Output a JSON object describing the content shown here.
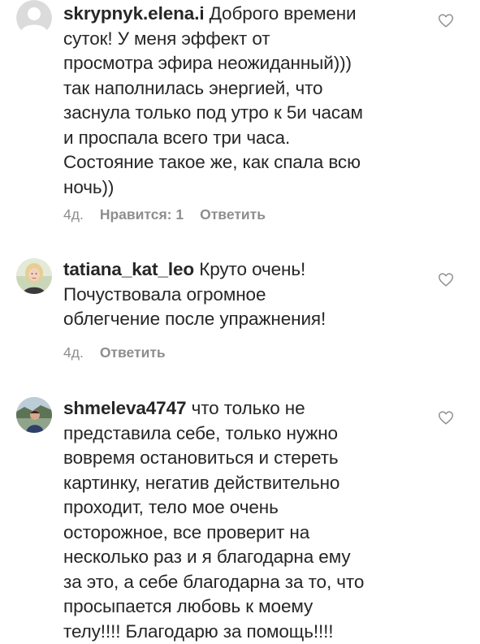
{
  "comments": [
    {
      "username": "skrypnyk.elena.i",
      "lines": [
        " Доброго времени",
        "суток!  У меня  эффект  от",
        "просмотра эфира неожиданный)))",
        "так наполнилась энергией, что",
        "заснула только под утро к 5и часам",
        "и  проспала всего три часа.",
        "Состояние такое же, как спала всю",
        "ночь))"
      ],
      "time": "4д.",
      "likes": "Нравится: 1",
      "reply": "Ответить",
      "avatar": "default-avatar"
    },
    {
      "username": "tatiana_kat_leo",
      "lines": [
        " Круто очень!",
        "Почуствовала огромное",
        "облегчение после упражнения!"
      ],
      "time": "4д.",
      "reply": "Ответить",
      "avatar": "photo-avatar-blonde-woman"
    },
    {
      "username": "shmeleva4747",
      "lines": [
        " что только не",
        "представила себе, только нужно",
        "вовремя остановиться и стереть",
        "картинку, негатив действительно",
        "проходит, тело мое очень",
        "осторожное, все проверит на",
        "несколько раз и я благодарна ему",
        "за это, а себе благодарна за то, что",
        "просыпается любовь к моему",
        "телу!!!! Благодарю за помощь!!!!"
      ],
      "avatar": "photo-avatar-person-outdoors"
    }
  ],
  "colors": {
    "text": "#262626",
    "secondary": "#8e8e8e",
    "heart_outline": "#8e8e8e"
  },
  "icons": {
    "like": "heart-outline-icon"
  }
}
